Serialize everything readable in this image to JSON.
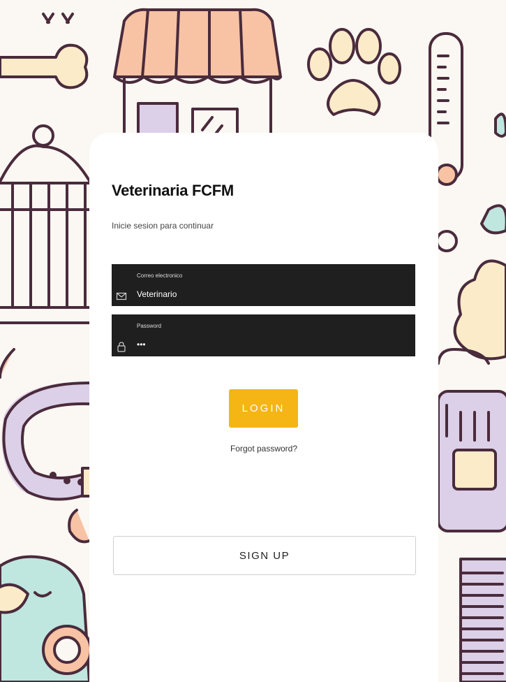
{
  "app": {
    "title": "Veterinaria FCFM",
    "subtitle": "Inicie sesion para continuar"
  },
  "form": {
    "email": {
      "label": "Correo electronico",
      "value": "Veterinario",
      "icon": "envelope-icon"
    },
    "password": {
      "label": "Password",
      "value": "•••",
      "icon": "lock-icon"
    },
    "login_label": "LOGIN",
    "forgot_label": "Forgot password?",
    "signup_label": "SIGN UP"
  },
  "colors": {
    "accent": "#f5b515",
    "field_bg": "#1f1f1f",
    "pet_peach": "#f7c3a4",
    "pet_cream": "#fbebc8",
    "pet_lilac": "#dccfe8",
    "pet_mint": "#bfe6df",
    "outline": "#4a2b3c"
  }
}
